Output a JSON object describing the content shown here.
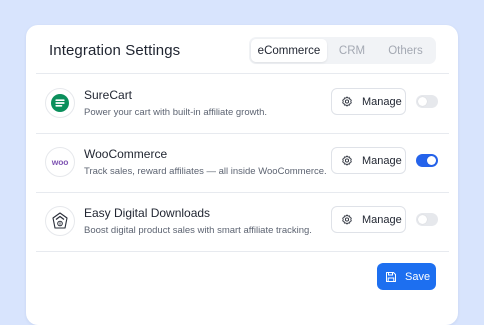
{
  "header": {
    "title": "Integration Settings",
    "tabs": [
      {
        "label": "eCommerce",
        "active": true
      },
      {
        "label": "CRM",
        "active": false
      },
      {
        "label": "Others",
        "active": false
      }
    ]
  },
  "integrations": [
    {
      "name": "SureCart",
      "description": "Power your cart with built-in affiliate growth.",
      "logo_icon": "surecart-logo-icon",
      "manage_label": "Manage",
      "enabled": false
    },
    {
      "name": "WooCommerce",
      "description": "Track sales, reward affiliates — all inside WooCommerce.",
      "logo_icon": "woocommerce-logo-icon",
      "logo_text": "woo",
      "manage_label": "Manage",
      "enabled": true
    },
    {
      "name": "Easy Digital Downloads",
      "description": "Boost digital product sales with smart affiliate tracking.",
      "logo_icon": "edd-logo-icon",
      "manage_label": "Manage",
      "enabled": false
    }
  ],
  "footer": {
    "save_label": "Save"
  },
  "colors": {
    "page_background": "#d8e4fd",
    "accent": "#1d6ff0",
    "toggle_on": "#2563eb",
    "toggle_off": "#e6e8ec",
    "surecart_green": "#0b8f5c",
    "woocommerce_purple": "#7f54b3"
  }
}
